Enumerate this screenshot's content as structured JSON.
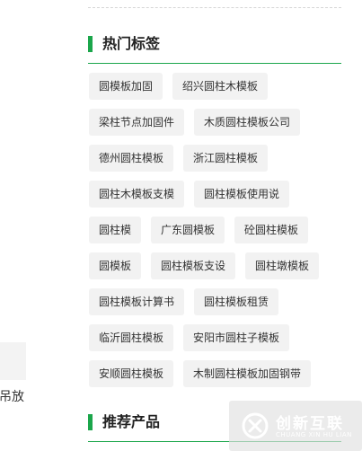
{
  "hot_tags": {
    "title": "热门标签",
    "rows": [
      [
        "圆模板加固",
        "绍兴圆柱木模板"
      ],
      [
        "梁柱节点加固件",
        "木质圆柱模板公司"
      ],
      [
        "德州圆柱模板",
        "浙江圆柱模板"
      ],
      [
        "圆柱木模板支模",
        "圆柱模板使用说"
      ],
      [
        "圆柱模",
        "广东圆模板",
        "砼圆柱模板"
      ],
      [
        "圆模板",
        "圆柱模板支设",
        "圆柱墩模板"
      ],
      [
        "圆柱模板计算书",
        "圆柱模板租赁"
      ],
      [
        "临沂圆柱模板",
        "安阳市圆柱子模板"
      ],
      [
        "安顺圆柱模板",
        "木制圆柱模板加固钢带"
      ]
    ]
  },
  "recommended": {
    "title": "推荐产品"
  },
  "left_partial_text": "吊放",
  "watermark": {
    "brand": "创新互联",
    "sub": "CHUANG XIN HU LIAN"
  },
  "colors": {
    "accent": "#1ba64b",
    "tag_bg": "#f2f2f2"
  }
}
